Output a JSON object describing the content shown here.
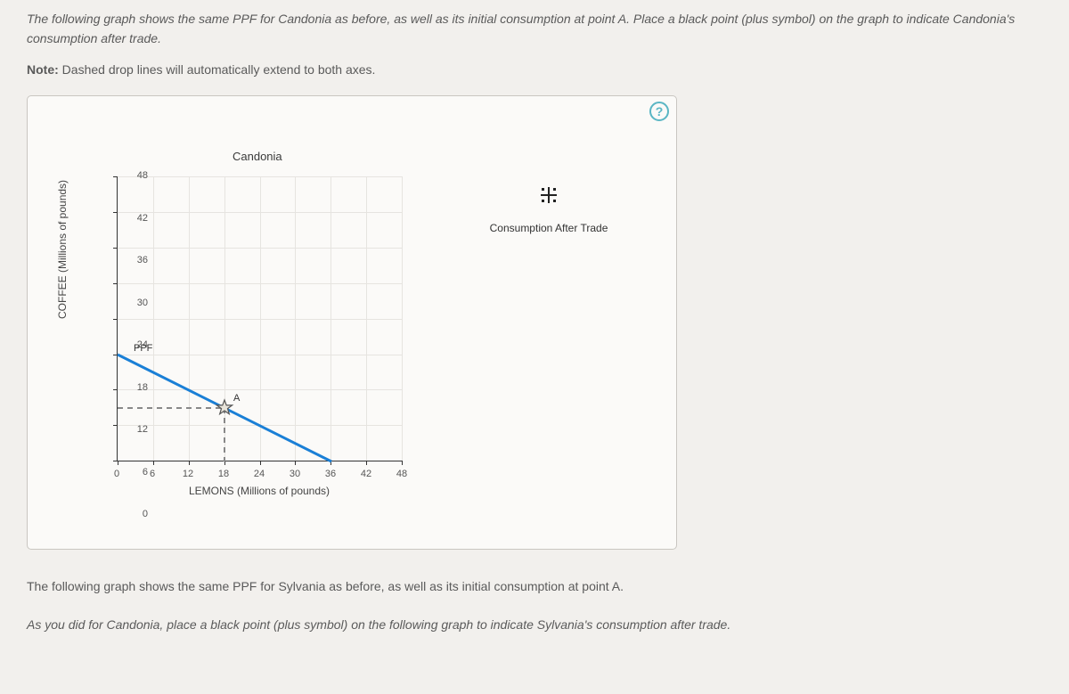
{
  "instruction1": "The following graph shows the same PPF for Candonia as before, as well as its initial consumption at point A. Place a black point (plus symbol) on the graph to indicate Candonia's consumption after trade.",
  "note_label": "Note:",
  "note_text": " Dashed drop lines will automatically extend to both axes.",
  "help_symbol": "?",
  "legend": {
    "label": "Consumption After Trade"
  },
  "after1": "The following graph shows the same PPF for Sylvania as before, as well as its initial consumption at point A.",
  "after2": "As you did for Candonia, place a black point (plus symbol) on the following graph to indicate Sylvania's consumption after trade.",
  "chart_data": {
    "type": "line",
    "title": "Candonia",
    "xlabel": "LEMONS (Millions of pounds)",
    "ylabel": "COFFEE (Millions of pounds)",
    "xlim": [
      0,
      48
    ],
    "ylim": [
      0,
      48
    ],
    "xticks": [
      0,
      6,
      12,
      18,
      24,
      30,
      36,
      42,
      48
    ],
    "yticks": [
      0,
      6,
      12,
      18,
      24,
      30,
      36,
      42,
      48
    ],
    "series": [
      {
        "name": "PPF",
        "x": [
          0,
          36
        ],
        "y": [
          18,
          0
        ]
      }
    ],
    "points": [
      {
        "name": "A",
        "x": 18,
        "y": 9,
        "drop_lines": true
      }
    ],
    "draggable_markers": [
      {
        "name": "Consumption After Trade",
        "symbol": "plus",
        "placed": false
      }
    ]
  }
}
